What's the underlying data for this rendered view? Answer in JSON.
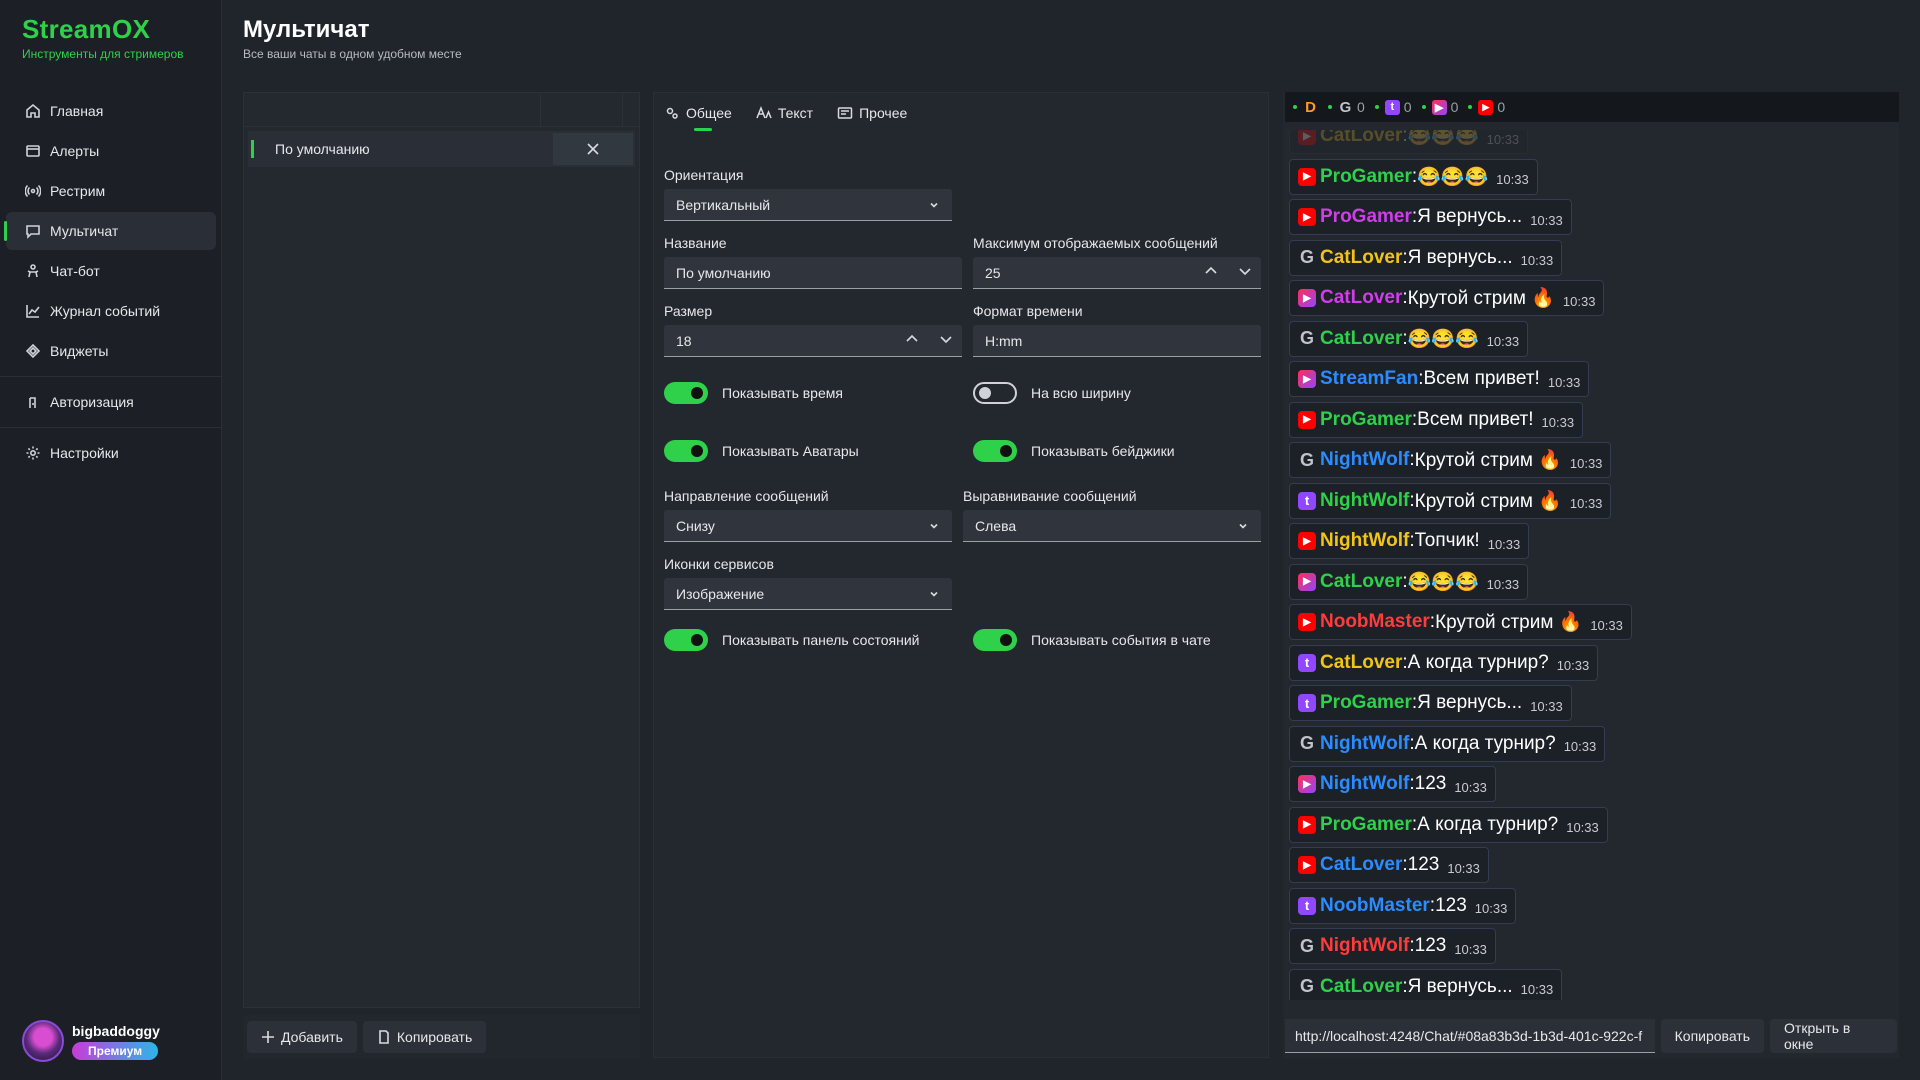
{
  "app": {
    "title": "StreamOX",
    "subtitle": "Инструменты для стримеров"
  },
  "colors": {
    "accent": "#2fd04a",
    "twitch": "#9146ff",
    "youtube": "#ff0000",
    "goodgame": "#2b6cff"
  },
  "nav": [
    {
      "label": "Главная",
      "icon": "home-icon"
    },
    {
      "label": "Алерты",
      "icon": "alert-icon"
    },
    {
      "label": "Рестрим",
      "icon": "broadcast-icon"
    },
    {
      "label": "Мультичат",
      "icon": "chat-icon",
      "active": true
    },
    {
      "label": "Чат-бот",
      "icon": "bot-icon"
    },
    {
      "label": "Журнал событий",
      "icon": "log-icon"
    },
    {
      "label": "Виджеты",
      "icon": "widgets-icon"
    },
    {
      "label": "Авторизация",
      "icon": "auth-icon"
    },
    {
      "label": "Настройки",
      "icon": "gear-icon"
    }
  ],
  "user": {
    "name": "bigbaddoggy",
    "badge": "Премиум"
  },
  "header": {
    "title": "Мультичат",
    "subtitle": "Все ваши чаты в одном удобном месте"
  },
  "presets": {
    "items": [
      {
        "name": "По умолчанию"
      }
    ],
    "add_label": "Добавить",
    "copy_label": "Копировать"
  },
  "tabs": [
    {
      "label": "Общее",
      "icon": "settings-general-icon"
    },
    {
      "label": "Текст",
      "icon": "text-icon"
    },
    {
      "label": "Прочее",
      "icon": "other-icon"
    }
  ],
  "settings": {
    "orientation": {
      "label": "Ориентация",
      "value": "Вертикальный"
    },
    "name": {
      "label": "Название",
      "value": "По умолчанию"
    },
    "max_messages": {
      "label": "Максимум отображаемых сообщений",
      "value": "25"
    },
    "size": {
      "label": "Размер",
      "value": "18"
    },
    "time_format": {
      "label": "Формат времени",
      "value": "H:mm"
    },
    "show_time": {
      "label": "Показывать время",
      "on": true
    },
    "full_width": {
      "label": "На всю ширину",
      "on": false
    },
    "show_avatars": {
      "label": "Показывать Аватары",
      "on": true
    },
    "show_badges": {
      "label": "Показывать бейджики",
      "on": true
    },
    "direction": {
      "label": "Направление сообщений",
      "value": "Снизу"
    },
    "alignment": {
      "label": "Выравнивание сообщений",
      "value": "Слева"
    },
    "service_icons": {
      "label": "Иконки сервисов",
      "value": "Изображение"
    },
    "show_status_panel": {
      "label": "Показывать панель состояний",
      "on": true
    },
    "show_events": {
      "label": "Показывать события в чате",
      "on": true
    }
  },
  "status": {
    "counts": [
      "0",
      "0",
      "0",
      "0"
    ]
  },
  "messages": [
    {
      "service": "youtube",
      "nick": "CatLover",
      "color": "#f0c419",
      "text": "😂😂😂",
      "time": "10:33",
      "faded": true
    },
    {
      "service": "youtube",
      "nick": "ProGamer",
      "color": "#2fd04a",
      "text": "😂😂😂",
      "time": "10:33"
    },
    {
      "service": "youtube",
      "nick": "ProGamer",
      "color": "#d13de8",
      "text": "Я вернусь...",
      "time": "10:33"
    },
    {
      "service": "goodgame",
      "nick": "CatLover",
      "color": "#f0c419",
      "text": "Я вернусь...",
      "time": "10:33"
    },
    {
      "service": "youtube-box",
      "nick": "CatLover",
      "color": "#d13de8",
      "text": "Крутой стрим 🔥",
      "time": "10:33"
    },
    {
      "service": "goodgame",
      "nick": "CatLover",
      "color": "#2fd04a",
      "text": "😂😂😂",
      "time": "10:33"
    },
    {
      "service": "youtube-box",
      "nick": "StreamFan",
      "color": "#2b8cff",
      "text": "Всем привет!",
      "time": "10:33"
    },
    {
      "service": "youtube",
      "nick": "ProGamer",
      "color": "#2fd04a",
      "text": "Всем привет!",
      "time": "10:33"
    },
    {
      "service": "goodgame",
      "nick": "NightWolf",
      "color": "#2b8cff",
      "text": "Крутой стрим 🔥",
      "time": "10:33"
    },
    {
      "service": "twitch",
      "nick": "NightWolf",
      "color": "#2fd04a",
      "text": "Крутой стрим 🔥",
      "time": "10:33"
    },
    {
      "service": "youtube",
      "nick": "NightWolf",
      "color": "#f0c419",
      "text": "Топчик!",
      "time": "10:33"
    },
    {
      "service": "youtube-box",
      "nick": "CatLover",
      "color": "#2fd04a",
      "text": "😂😂😂",
      "time": "10:33"
    },
    {
      "service": "youtube",
      "nick": "NoobMaster",
      "color": "#ff3b3b",
      "text": "Крутой стрим 🔥",
      "time": "10:33"
    },
    {
      "service": "twitch",
      "nick": "CatLover",
      "color": "#f0c419",
      "text": "А когда турнир?",
      "time": "10:33"
    },
    {
      "service": "twitch",
      "nick": "ProGamer",
      "color": "#2fd04a",
      "text": "Я вернусь...",
      "time": "10:33"
    },
    {
      "service": "goodgame",
      "nick": "NightWolf",
      "color": "#2b8cff",
      "text": "А когда турнир?",
      "time": "10:33"
    },
    {
      "service": "youtube-box",
      "nick": "NightWolf",
      "color": "#2b8cff",
      "text": "123",
      "time": "10:33"
    },
    {
      "service": "youtube",
      "nick": "ProGamer",
      "color": "#2fd04a",
      "text": "А когда турнир?",
      "time": "10:33"
    },
    {
      "service": "youtube",
      "nick": "CatLover",
      "color": "#2b8cff",
      "text": "123",
      "time": "10:33"
    },
    {
      "service": "twitch",
      "nick": "NoobMaster",
      "color": "#2b8cff",
      "text": "123",
      "time": "10:33"
    },
    {
      "service": "goodgame",
      "nick": "NightWolf",
      "color": "#ff3b3b",
      "text": "123",
      "time": "10:33"
    },
    {
      "service": "goodgame",
      "nick": "CatLover",
      "color": "#2fd04a",
      "text": "Я вернусь...",
      "time": "10:33"
    }
  ],
  "preview": {
    "url": "http://localhost:4248/Chat/#08a83b3d-1b3d-401c-922c-f",
    "copy_label": "Копировать",
    "open_label": "Открыть в окне"
  }
}
